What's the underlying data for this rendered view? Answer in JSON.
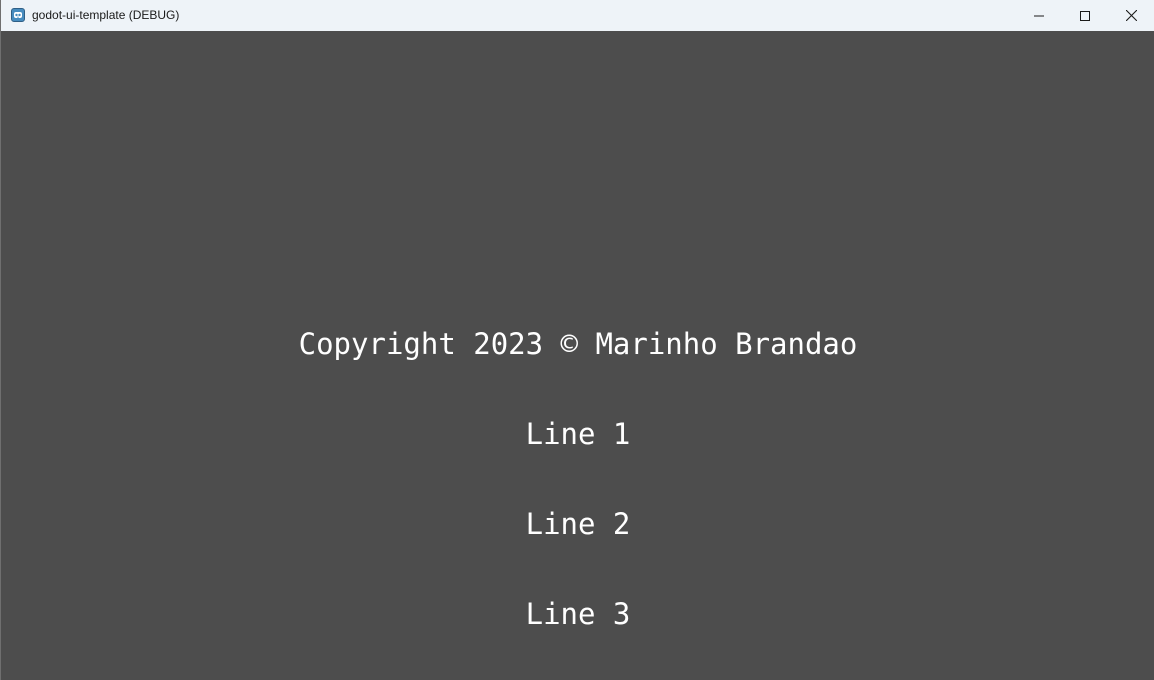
{
  "window": {
    "title": "godot-ui-template (DEBUG)",
    "app_icon": "godot-icon",
    "controls": {
      "minimize_icon": "minimize-icon",
      "maximize_icon": "maximize-icon",
      "close_icon": "close-icon"
    }
  },
  "credits": {
    "copyright": "Copyright 2023 © Marinho Brandao",
    "lines": [
      "Line 1",
      "Line 2",
      "Line 3"
    ]
  },
  "colors": {
    "background": "#4d4d4d",
    "titlebar": "#eef3f8",
    "text": "#ffffff"
  }
}
